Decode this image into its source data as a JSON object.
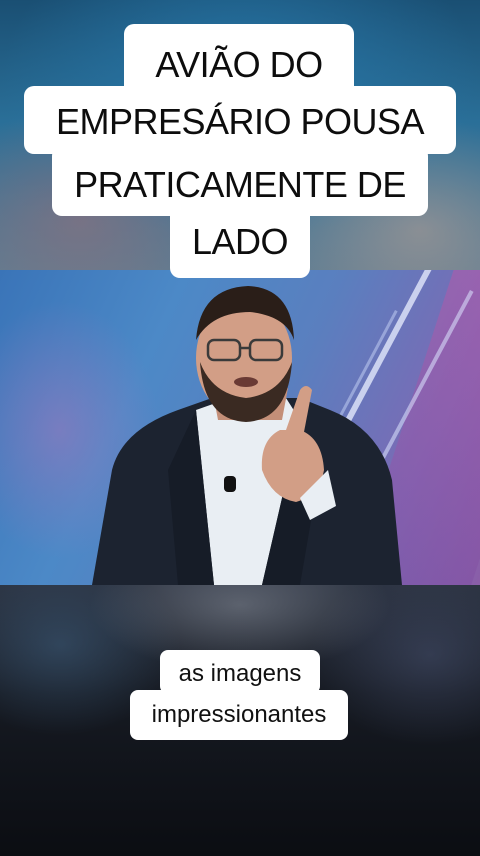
{
  "headline": {
    "line1": "AVIÃO DO",
    "line2": "EMPRESÁRIO POUSA",
    "line3": "PRATICAMENTE DE",
    "line4": "LADO"
  },
  "subtitle": {
    "line1": "as imagens",
    "line2": "impressionantes"
  },
  "colors": {
    "caption_bg": "#ffffff",
    "caption_text": "#111111",
    "studio_blue": "#4c89c7",
    "studio_purple": "#8a5ea8"
  }
}
